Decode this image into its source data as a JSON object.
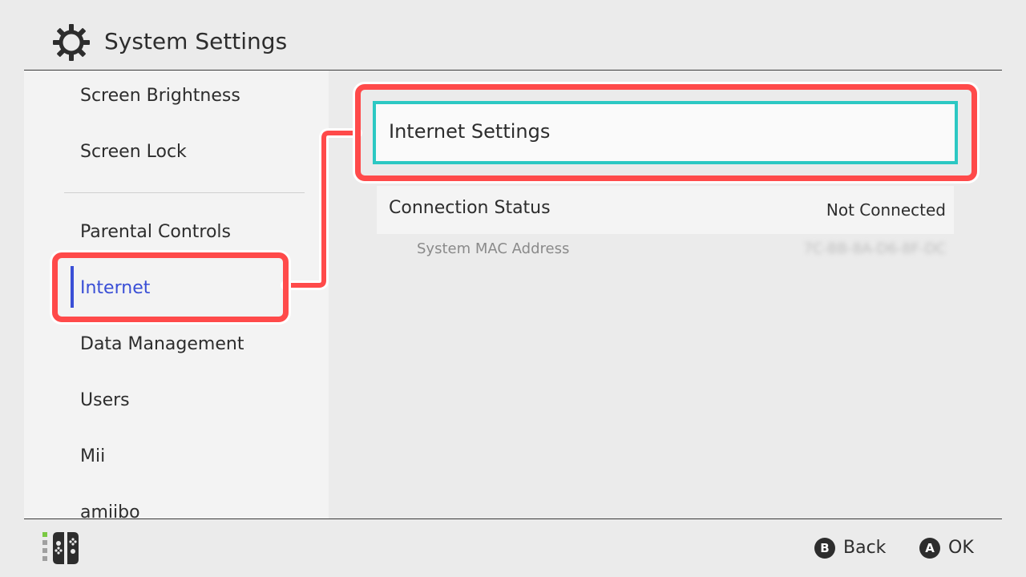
{
  "header": {
    "title": "System Settings",
    "icon": "gear-icon"
  },
  "sidebar": {
    "items": [
      {
        "label": "Screen Brightness"
      },
      {
        "label": "Screen Lock"
      },
      {
        "label": "Parental Controls"
      },
      {
        "label": "Internet"
      },
      {
        "label": "Data Management"
      },
      {
        "label": "Users"
      },
      {
        "label": "Mii"
      },
      {
        "label": "amiibo"
      }
    ],
    "selected_label": "Internet"
  },
  "main": {
    "internet_settings_label": "Internet Settings",
    "connection_status": {
      "label": "Connection Status",
      "value": "Not Connected"
    },
    "mac_address": {
      "label": "System MAC Address",
      "value": "7C-BB-8A-D6-8F-DC"
    }
  },
  "footer": {
    "back": {
      "button": "B",
      "label": "Back"
    },
    "ok": {
      "button": "A",
      "label": "OK"
    },
    "controller_icon": "joy-con-icon"
  },
  "colors": {
    "highlight": "#ff4a4a",
    "focus": "#2cc8c3",
    "active": "#3a4fd6",
    "background": "#ebebeb"
  }
}
